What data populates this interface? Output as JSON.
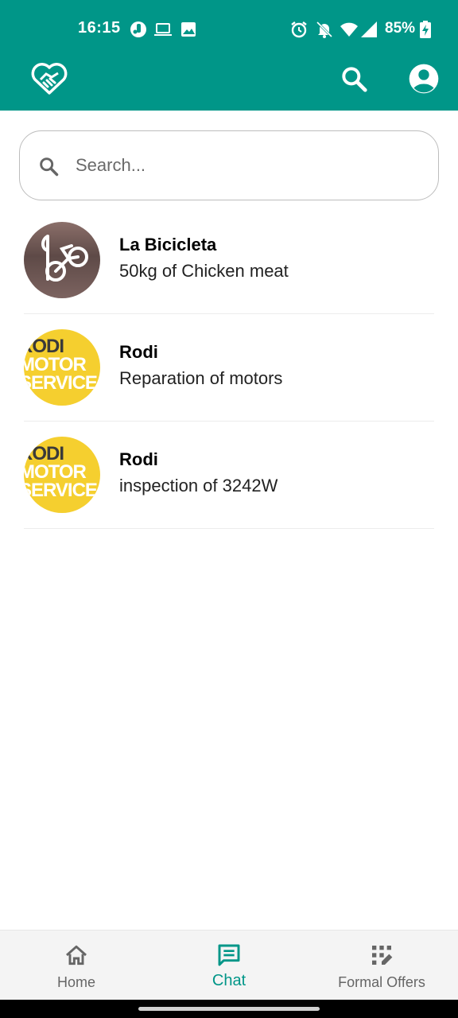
{
  "status_bar": {
    "time": "16:15",
    "battery": "85%",
    "left_icons": [
      "vpn-icon",
      "laptop-icon",
      "image-icon"
    ],
    "right_icons": [
      "alarm-icon",
      "notifications-off-icon",
      "wifi-icon",
      "signal-icon",
      "battery-charging-icon"
    ]
  },
  "app_bar": {
    "background_color": "#009688",
    "logo_icon": "heart-handshake-icon",
    "actions": [
      "search-icon",
      "account-circle-icon"
    ]
  },
  "search": {
    "placeholder": "Search...",
    "value": ""
  },
  "chats": [
    {
      "name": "La Bicicleta",
      "subject": "50kg of Chicken meat",
      "avatar": "bicycle-logo"
    },
    {
      "name": "Rodi",
      "subject": "Reparation of motors",
      "avatar": "rodi-motor-service-logo"
    },
    {
      "name": "Rodi",
      "subject": "inspection of 3242W",
      "avatar": "rodi-motor-service-logo"
    }
  ],
  "logos": {
    "rodi": [
      "RODI",
      "MOTOR",
      "SERVICE"
    ]
  },
  "bottom_nav": {
    "items": [
      {
        "label": "Home",
        "icon": "home-icon",
        "active": false
      },
      {
        "label": "Chat",
        "icon": "chat-icon",
        "active": true
      },
      {
        "label": "Formal Offers",
        "icon": "offers-grid-icon",
        "active": false
      }
    ],
    "active_color": "#009688"
  }
}
